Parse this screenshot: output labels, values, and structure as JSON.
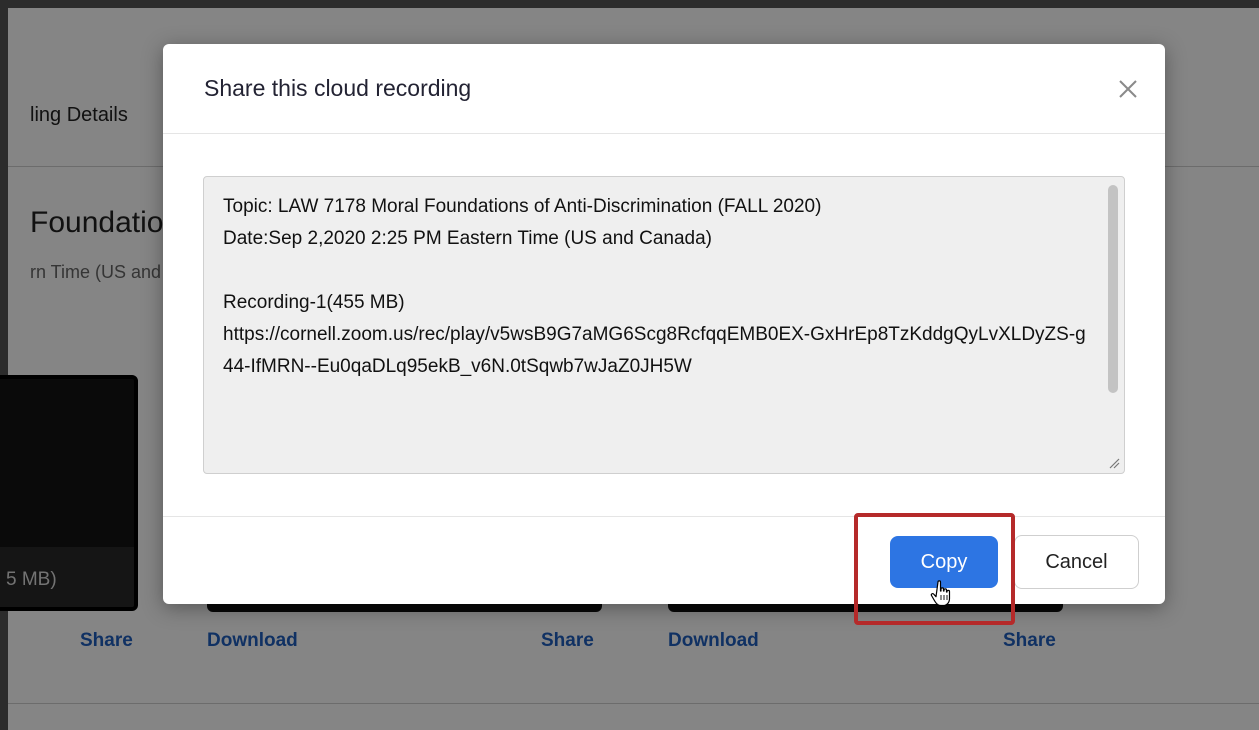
{
  "background": {
    "tab_label": "ling Details",
    "meeting_title": "Foundation",
    "meeting_subtitle": "rn Time (US and",
    "recording_size": "5 MB)",
    "links": {
      "share_1": "Share",
      "download_1": "Download",
      "share_2": "Share",
      "download_2": "Download",
      "share_3": "Share"
    }
  },
  "modal": {
    "title": "Share this cloud recording",
    "close_icon": "close-icon",
    "content": "Topic: LAW 7178 Moral Foundations of Anti-Discrimination (FALL 2020)\nDate:Sep 2,2020 2:25 PM Eastern Time (US and Canada)\n\nRecording-1(455 MB)\nhttps://cornell.zoom.us/rec/play/v5wsB9G7aMG6Scg8RcfqqEMB0EX-GxHrEp8TzKddgQyLvXLDyZS-g44-IfMRN--Eu0qaDLq95ekB_v6N.0tSqwb7wJaZ0JH5W",
    "copy_label": "Copy",
    "cancel_label": "Cancel"
  },
  "colors": {
    "primary": "#2d75e3",
    "link": "#1f5fbf",
    "highlight": "#b52a2a"
  }
}
